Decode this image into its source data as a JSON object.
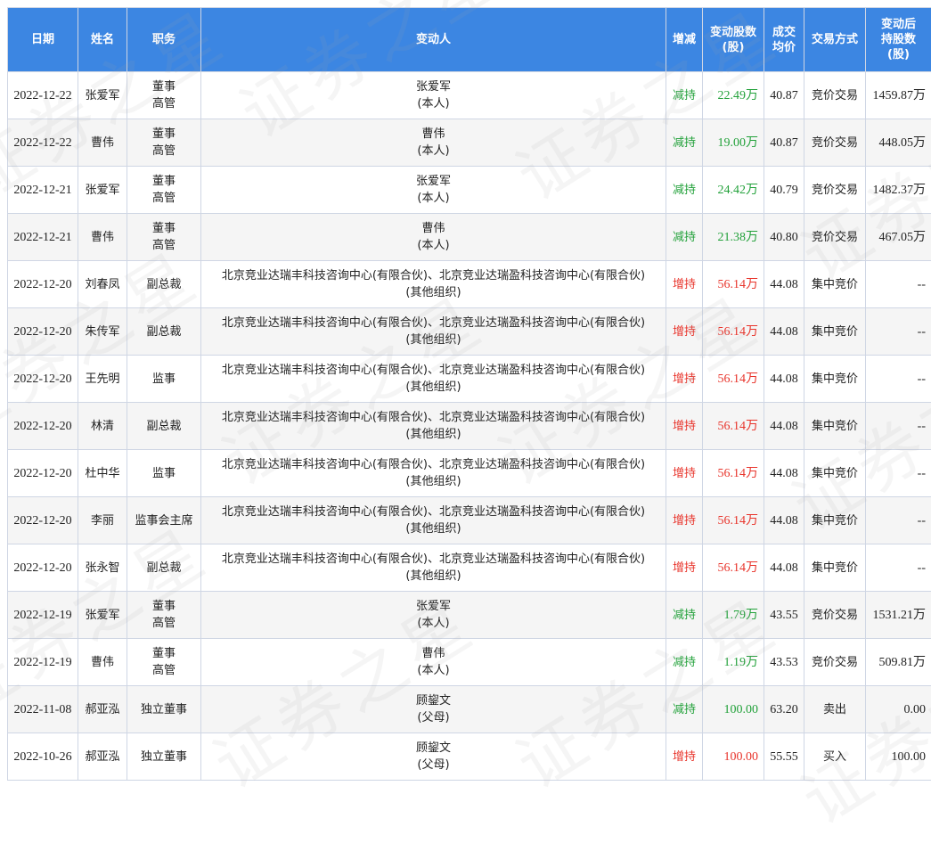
{
  "header": {
    "date": "日期",
    "name": "姓名",
    "position": "职务",
    "changer": "变动人",
    "direction": "增减",
    "shares": "变动股数(股)",
    "price": "成交均价",
    "method": "交易方式",
    "after": "变动后持股数(股)"
  },
  "watermark_text": "证券之星",
  "colors": {
    "header_bg": "#3c86e2",
    "decrease": "#22a13a",
    "increase": "#e8342b"
  },
  "rows": [
    {
      "date": "2022-12-22",
      "name": "张爱军",
      "position": "董事\n高管",
      "changer": "张爱军\n(本人)",
      "direction": "减持",
      "shares": "22.49万",
      "price": "40.87",
      "method": "竞价交易",
      "after": "1459.87万"
    },
    {
      "date": "2022-12-22",
      "name": "曹伟",
      "position": "董事\n高管",
      "changer": "曹伟\n(本人)",
      "direction": "减持",
      "shares": "19.00万",
      "price": "40.87",
      "method": "竞价交易",
      "after": "448.05万"
    },
    {
      "date": "2022-12-21",
      "name": "张爱军",
      "position": "董事\n高管",
      "changer": "张爱军\n(本人)",
      "direction": "减持",
      "shares": "24.42万",
      "price": "40.79",
      "method": "竞价交易",
      "after": "1482.37万"
    },
    {
      "date": "2022-12-21",
      "name": "曹伟",
      "position": "董事\n高管",
      "changer": "曹伟\n(本人)",
      "direction": "减持",
      "shares": "21.38万",
      "price": "40.80",
      "method": "竞价交易",
      "after": "467.05万"
    },
    {
      "date": "2022-12-20",
      "name": "刘春凤",
      "position": "副总裁",
      "changer": "北京竞业达瑞丰科技咨询中心(有限合伙)、北京竞业达瑞盈科技咨询中心(有限合伙)\n(其他组织)",
      "direction": "增持",
      "shares": "56.14万",
      "price": "44.08",
      "method": "集中竞价",
      "after": "--"
    },
    {
      "date": "2022-12-20",
      "name": "朱传军",
      "position": "副总裁",
      "changer": "北京竞业达瑞丰科技咨询中心(有限合伙)、北京竞业达瑞盈科技咨询中心(有限合伙)\n(其他组织)",
      "direction": "增持",
      "shares": "56.14万",
      "price": "44.08",
      "method": "集中竞价",
      "after": "--"
    },
    {
      "date": "2022-12-20",
      "name": "王先明",
      "position": "监事",
      "changer": "北京竞业达瑞丰科技咨询中心(有限合伙)、北京竞业达瑞盈科技咨询中心(有限合伙)\n(其他组织)",
      "direction": "增持",
      "shares": "56.14万",
      "price": "44.08",
      "method": "集中竞价",
      "after": "--"
    },
    {
      "date": "2022-12-20",
      "name": "林清",
      "position": "副总裁",
      "changer": "北京竞业达瑞丰科技咨询中心(有限合伙)、北京竞业达瑞盈科技咨询中心(有限合伙)\n(其他组织)",
      "direction": "增持",
      "shares": "56.14万",
      "price": "44.08",
      "method": "集中竞价",
      "after": "--"
    },
    {
      "date": "2022-12-20",
      "name": "杜中华",
      "position": "监事",
      "changer": "北京竞业达瑞丰科技咨询中心(有限合伙)、北京竞业达瑞盈科技咨询中心(有限合伙)\n(其他组织)",
      "direction": "增持",
      "shares": "56.14万",
      "price": "44.08",
      "method": "集中竞价",
      "after": "--"
    },
    {
      "date": "2022-12-20",
      "name": "李丽",
      "position": "监事会主席",
      "changer": "北京竞业达瑞丰科技咨询中心(有限合伙)、北京竞业达瑞盈科技咨询中心(有限合伙)\n(其他组织)",
      "direction": "增持",
      "shares": "56.14万",
      "price": "44.08",
      "method": "集中竞价",
      "after": "--"
    },
    {
      "date": "2022-12-20",
      "name": "张永智",
      "position": "副总裁",
      "changer": "北京竞业达瑞丰科技咨询中心(有限合伙)、北京竞业达瑞盈科技咨询中心(有限合伙)\n(其他组织)",
      "direction": "增持",
      "shares": "56.14万",
      "price": "44.08",
      "method": "集中竞价",
      "after": "--"
    },
    {
      "date": "2022-12-19",
      "name": "张爱军",
      "position": "董事\n高管",
      "changer": "张爱军\n(本人)",
      "direction": "减持",
      "shares": "1.79万",
      "price": "43.55",
      "method": "竞价交易",
      "after": "1531.21万"
    },
    {
      "date": "2022-12-19",
      "name": "曹伟",
      "position": "董事\n高管",
      "changer": "曹伟\n(本人)",
      "direction": "减持",
      "shares": "1.19万",
      "price": "43.53",
      "method": "竞价交易",
      "after": "509.81万"
    },
    {
      "date": "2022-11-08",
      "name": "郝亚泓",
      "position": "独立董事",
      "changer": "顾鋆文\n(父母)",
      "direction": "减持",
      "shares": "100.00",
      "price": "63.20",
      "method": "卖出",
      "after": "0.00"
    },
    {
      "date": "2022-10-26",
      "name": "郝亚泓",
      "position": "独立董事",
      "changer": "顾鋆文\n(父母)",
      "direction": "增持",
      "shares": "100.00",
      "price": "55.55",
      "method": "买入",
      "after": "100.00"
    }
  ]
}
